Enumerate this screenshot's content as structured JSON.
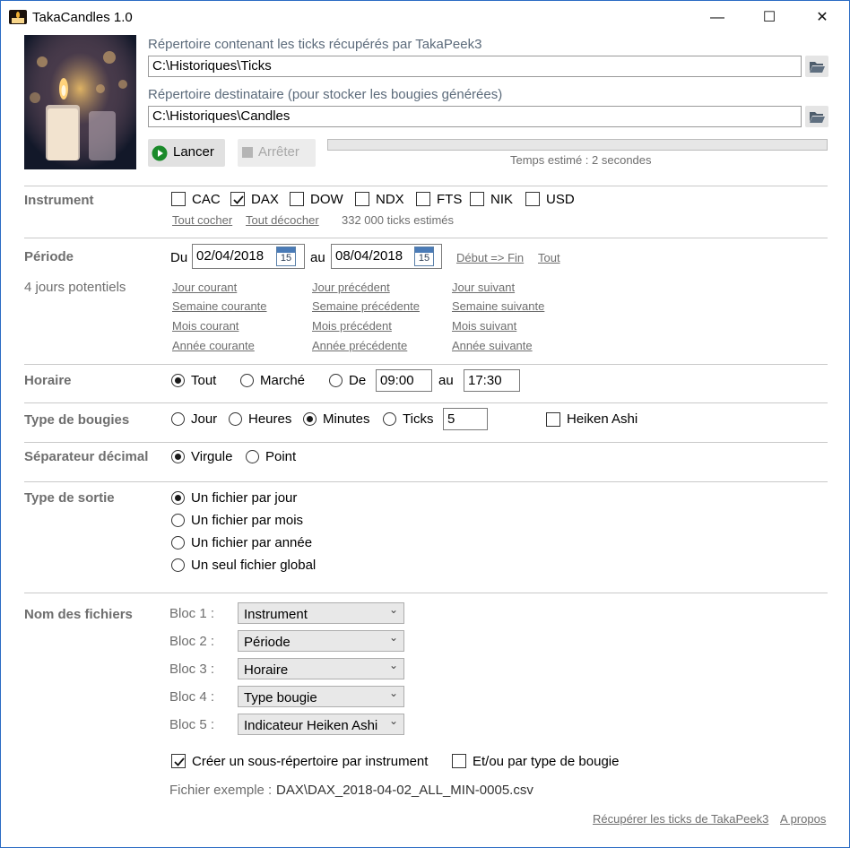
{
  "window": {
    "title": "TakaCandles 1.0",
    "minimize": "—",
    "maximize": "☐",
    "close": "✕"
  },
  "paths": {
    "source_label": "Répertoire contenant les ticks récupérés par TakaPeek3",
    "source_value": "C:\\Historiques\\Ticks",
    "dest_label": "Répertoire destinataire (pour stocker les bougies générées)",
    "dest_value": "C:\\Historiques\\Candles"
  },
  "actions": {
    "start_label": "Lancer",
    "stop_label": "Arrêter",
    "estimate": "Temps estimé : 2 secondes",
    "progress": 0
  },
  "instrument": {
    "label": "Instrument",
    "items": [
      {
        "label": "CAC",
        "checked": false
      },
      {
        "label": "DAX",
        "checked": true
      },
      {
        "label": "DOW",
        "checked": false
      },
      {
        "label": "NDX",
        "checked": false
      },
      {
        "label": "FTS",
        "checked": false
      },
      {
        "label": "NIK",
        "checked": false
      },
      {
        "label": "USD",
        "checked": false
      }
    ],
    "check_all": "Tout cocher",
    "uncheck_all": "Tout décocher",
    "ticks_estimate": "332 000 ticks estimés"
  },
  "periode": {
    "label": "Période",
    "du": "Du",
    "from": "02/04/2018",
    "au": "au",
    "to": "08/04/2018",
    "calendar_day": "15",
    "debut_fin": "Début => Fin",
    "tout": "Tout",
    "potential": "4 jours potentiels",
    "links": [
      [
        "Jour courant",
        "Jour précédent",
        "Jour suivant"
      ],
      [
        "Semaine courante",
        "Semaine précédente",
        "Semaine suivante"
      ],
      [
        "Mois courant",
        "Mois précédent",
        "Mois suivant"
      ],
      [
        "Année courante",
        "Année précédente",
        "Année suivante"
      ]
    ]
  },
  "horaire": {
    "label": "Horaire",
    "tout": "Tout",
    "marche": "Marché",
    "de": "De",
    "from": "09:00",
    "au": "au",
    "to": "17:30",
    "selected": "tout"
  },
  "bougies": {
    "label": "Type de bougies",
    "jour": "Jour",
    "heures": "Heures",
    "minutes": "Minutes",
    "ticks": "Ticks",
    "value": "5",
    "heiken": "Heiken Ashi",
    "selected": "minutes"
  },
  "separateur": {
    "label": "Séparateur décimal",
    "virgule": "Virgule",
    "point": "Point",
    "selected": "virgule"
  },
  "sortie": {
    "label": "Type de sortie",
    "options": [
      "Un fichier par jour",
      "Un fichier par mois",
      "Un fichier par année",
      "Un seul fichier global"
    ],
    "selected_index": 0
  },
  "noms": {
    "label": "Nom des fichiers",
    "blocs": [
      {
        "label": "Bloc 1 :",
        "value": "Instrument"
      },
      {
        "label": "Bloc 2 :",
        "value": "Période"
      },
      {
        "label": "Bloc 3 :",
        "value": "Horaire"
      },
      {
        "label": "Bloc 4 :",
        "value": "Type bougie"
      },
      {
        "label": "Bloc 5 :",
        "value": "Indicateur Heiken Ashi"
      }
    ],
    "subdir_instrument": "Créer un sous-répertoire par instrument",
    "subdir_type": "Et/ou par type de bougie",
    "example_label": "Fichier exemple :",
    "example_value": "DAX\\DAX_2018-04-02_ALL_MIN-0005.csv"
  },
  "footer": {
    "fetch_link": "Récupérer les ticks de TakaPeek3",
    "about_link": "A propos"
  }
}
